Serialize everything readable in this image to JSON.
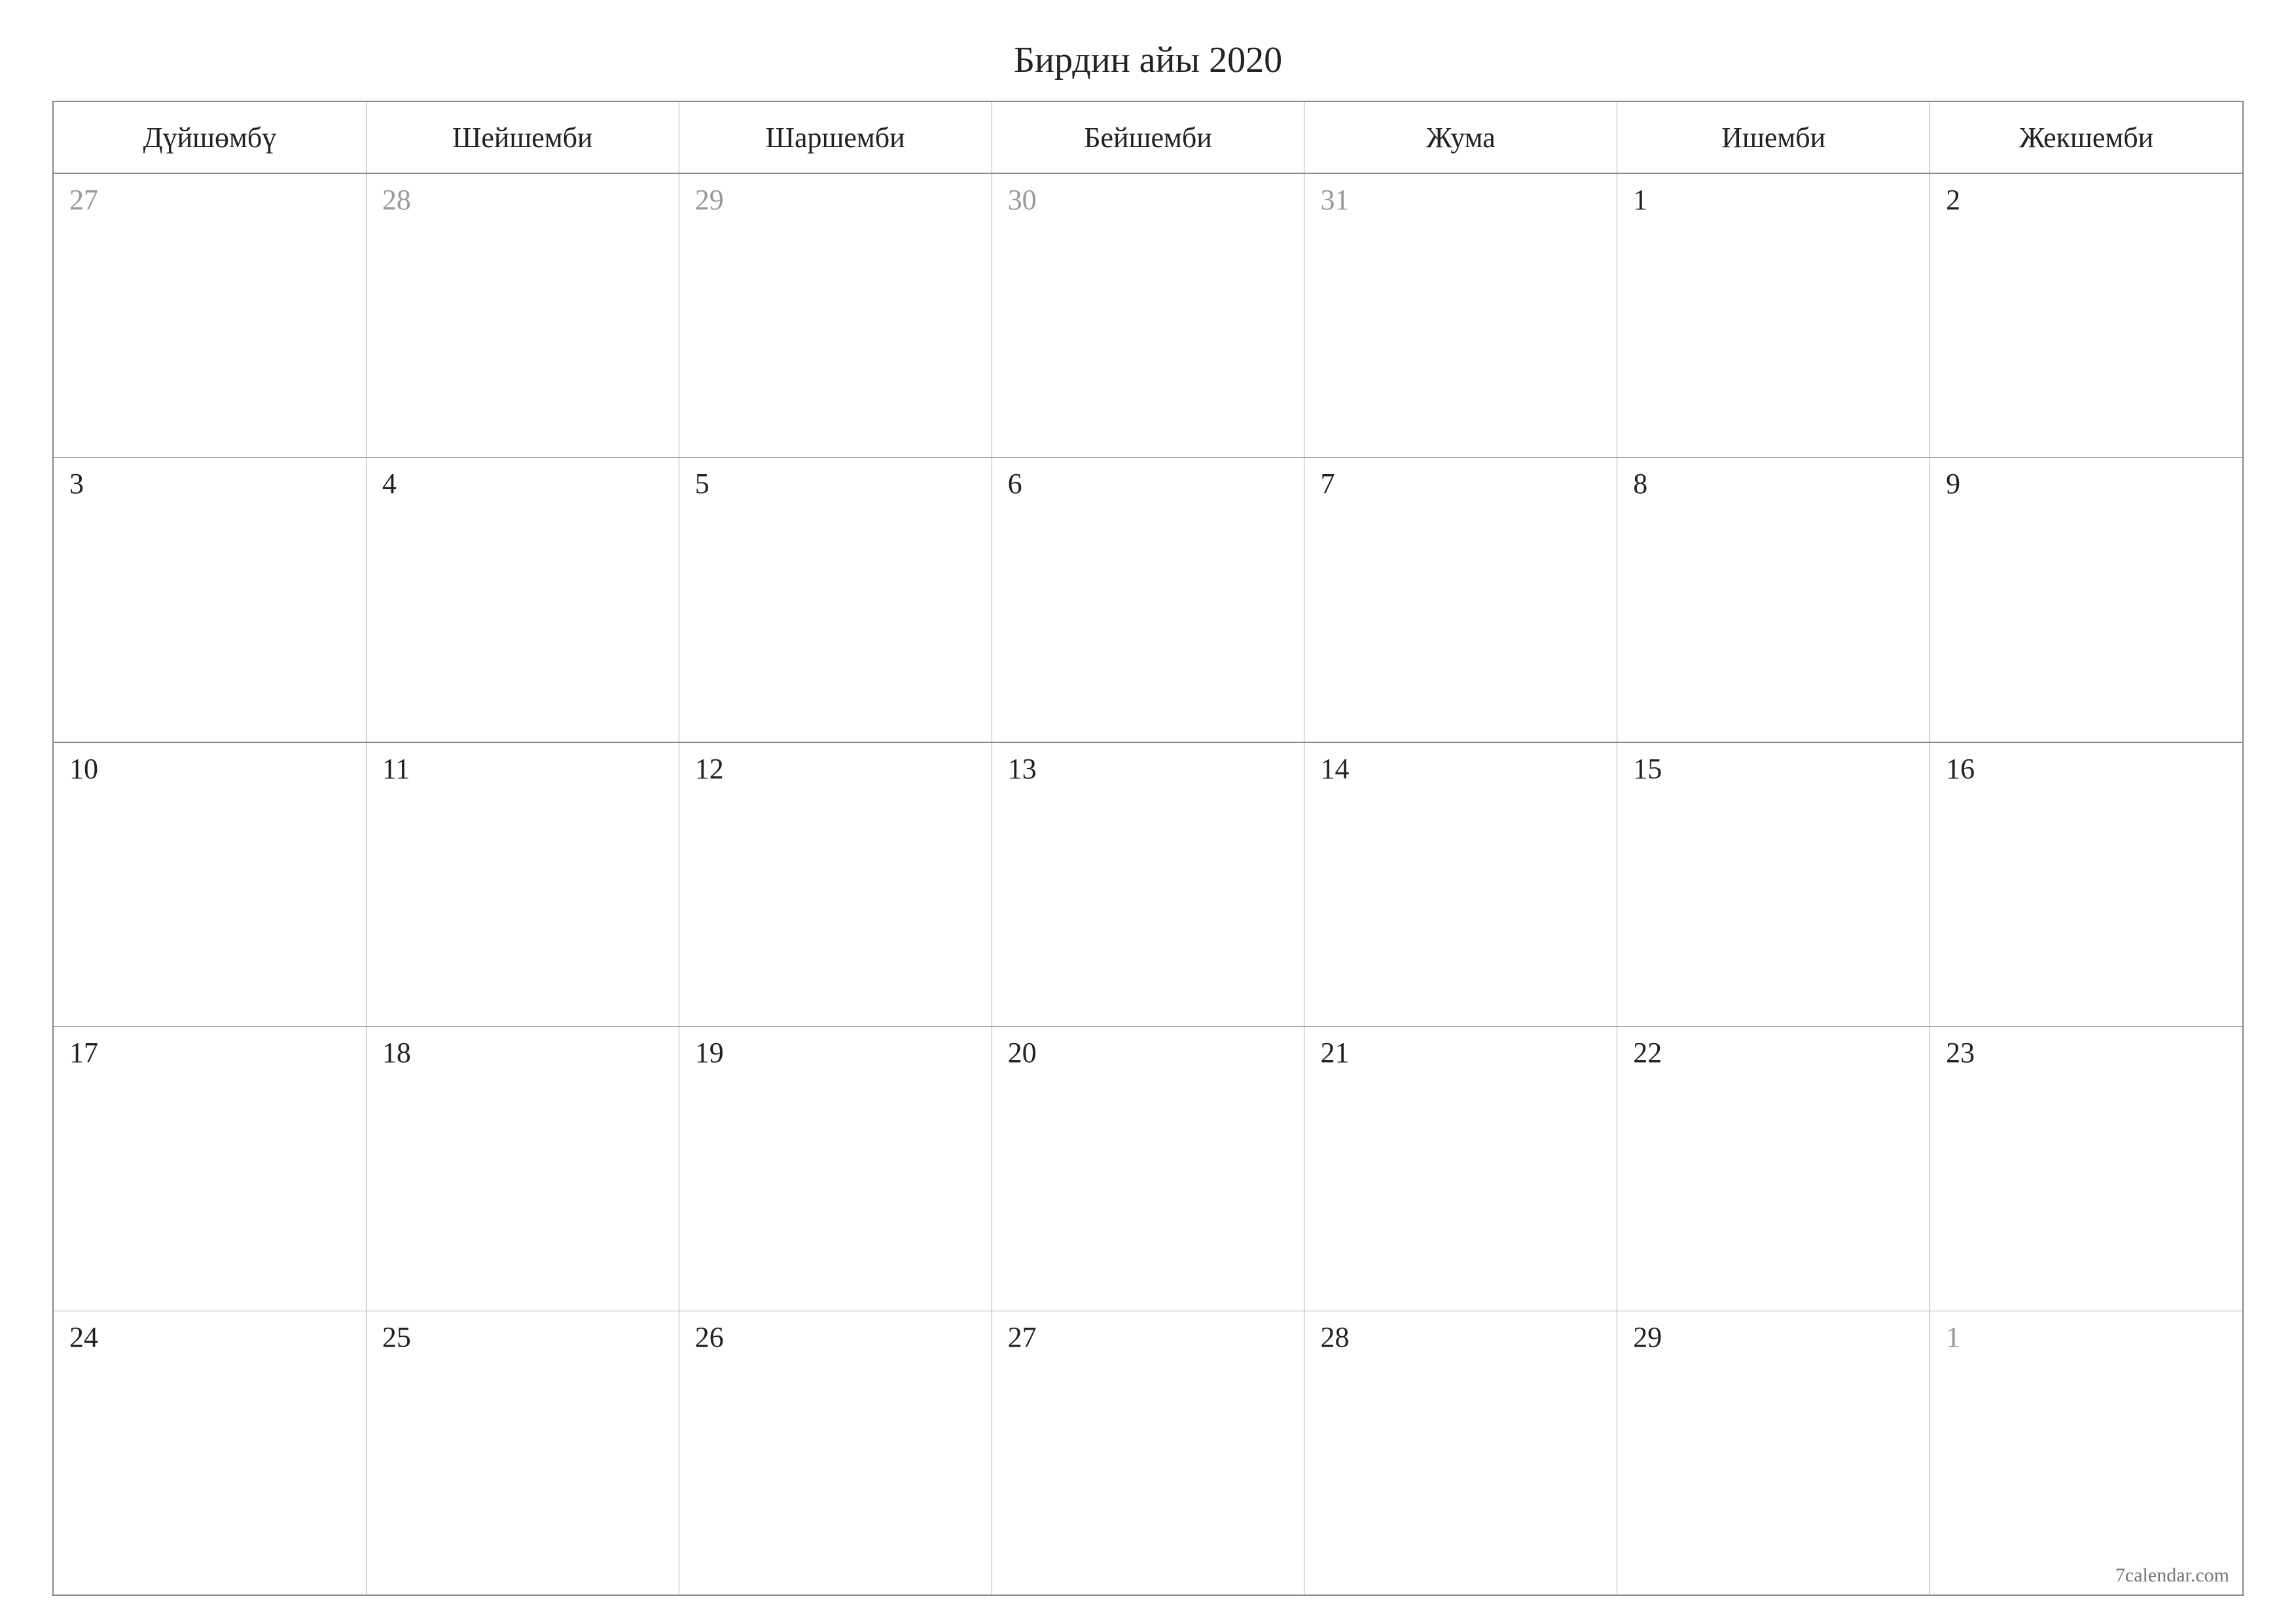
{
  "title": "Бирдин айы 2020",
  "weekdays": [
    "Дүйшөмбү",
    "Шейшемби",
    "Шаршемби",
    "Бейшемби",
    "Жума",
    "Ишемби",
    "Жекшемби"
  ],
  "weeks": [
    {
      "thick_top": false,
      "days": [
        {
          "n": "27",
          "muted": true
        },
        {
          "n": "28",
          "muted": true
        },
        {
          "n": "29",
          "muted": true
        },
        {
          "n": "30",
          "muted": true
        },
        {
          "n": "31",
          "muted": true
        },
        {
          "n": "1",
          "muted": false
        },
        {
          "n": "2",
          "muted": false
        }
      ]
    },
    {
      "thick_top": false,
      "days": [
        {
          "n": "3",
          "muted": false
        },
        {
          "n": "4",
          "muted": false
        },
        {
          "n": "5",
          "muted": false
        },
        {
          "n": "6",
          "muted": false
        },
        {
          "n": "7",
          "muted": false
        },
        {
          "n": "8",
          "muted": false
        },
        {
          "n": "9",
          "muted": false
        }
      ]
    },
    {
      "thick_top": true,
      "days": [
        {
          "n": "10",
          "muted": false
        },
        {
          "n": "11",
          "muted": false
        },
        {
          "n": "12",
          "muted": false
        },
        {
          "n": "13",
          "muted": false
        },
        {
          "n": "14",
          "muted": false
        },
        {
          "n": "15",
          "muted": false
        },
        {
          "n": "16",
          "muted": false
        }
      ]
    },
    {
      "thick_top": false,
      "days": [
        {
          "n": "17",
          "muted": false
        },
        {
          "n": "18",
          "muted": false
        },
        {
          "n": "19",
          "muted": false
        },
        {
          "n": "20",
          "muted": false
        },
        {
          "n": "21",
          "muted": false
        },
        {
          "n": "22",
          "muted": false
        },
        {
          "n": "23",
          "muted": false
        }
      ]
    },
    {
      "thick_top": false,
      "days": [
        {
          "n": "24",
          "muted": false
        },
        {
          "n": "25",
          "muted": false
        },
        {
          "n": "26",
          "muted": false
        },
        {
          "n": "27",
          "muted": false
        },
        {
          "n": "28",
          "muted": false
        },
        {
          "n": "29",
          "muted": false
        },
        {
          "n": "1",
          "muted": true
        }
      ]
    }
  ],
  "footer": "7calendar.com"
}
